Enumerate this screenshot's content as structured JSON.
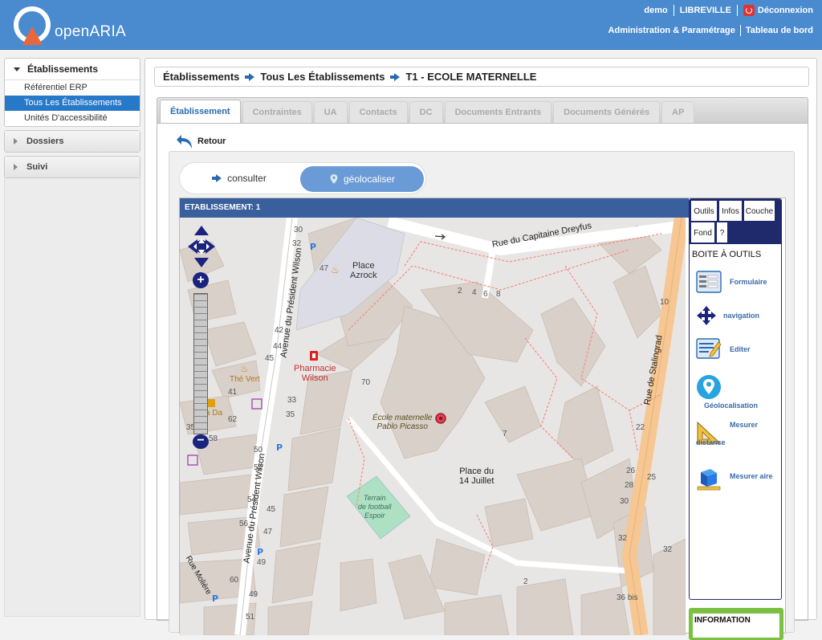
{
  "header": {
    "app_name": "openARIA",
    "user": "demo",
    "collectivite": "LIBREVILLE",
    "logout_label": "Déconnexion",
    "admin_label": "Administration & Paramétrage",
    "dashboard_label": "Tableau de bord",
    "brand_color": "#4a8bd0"
  },
  "sidebar": {
    "etablissements": {
      "title": "Établissements",
      "items": [
        {
          "label": "Référentiel ERP",
          "active": false
        },
        {
          "label": "Tous Les Établissements",
          "active": true
        },
        {
          "label": "Unités D'accessibilité",
          "active": false
        }
      ]
    },
    "dossiers": {
      "title": "Dossiers"
    },
    "suivi": {
      "title": "Suivi"
    }
  },
  "breadcrumb": [
    "Établissements",
    "Tous Les Établissements",
    "T1 - ECOLE MATERNELLE"
  ],
  "tabs": [
    {
      "label": "Établissement",
      "active": true
    },
    {
      "label": "Contraintes",
      "active": false
    },
    {
      "label": "UA",
      "active": false
    },
    {
      "label": "Contacts",
      "active": false
    },
    {
      "label": "DC",
      "active": false
    },
    {
      "label": "Documents Entrants",
      "active": false
    },
    {
      "label": "Documents Générés",
      "active": false
    },
    {
      "label": "AP",
      "active": false
    }
  ],
  "retour_label": "Retour",
  "mode_toggle": {
    "consult_label": "consulter",
    "geoloc_label": "géolocaliser",
    "active": "géolocaliser"
  },
  "map": {
    "title": "ETABLISSEMENT: 1",
    "labels": {
      "place_azrock": "Place\nAzrock",
      "rue_dreyfus": "Rue du Capitaine Dreyfus",
      "av_wilson_1": "Avenue du Président Wilson",
      "av_wilson_2": "Avenue du Président Wilson",
      "rue_stalingrad": "Rue de Stalingrad",
      "pharmacie": "Pharmacie\nWilson",
      "ecole": "École maternelle\nPablo Picasso",
      "place_14": "Place du\n14 Juillet",
      "terrain": "Terrain\nde football\nEspoir",
      "the_vert": "Thé Vert",
      "va_da": "Va Da",
      "rue_moliere": "Rue Molière"
    },
    "house_numbers": [
      "30",
      "32",
      "47",
      "2",
      "4",
      "6",
      "8",
      "42",
      "44",
      "45",
      "70",
      "41",
      "33",
      "35",
      "62",
      "7",
      "22",
      "35",
      "58",
      "50",
      "52",
      "54",
      "56",
      "47",
      "49",
      "45",
      "60",
      "49",
      "51",
      "10",
      "26",
      "25",
      "28",
      "30",
      "32",
      "32",
      "36 bis",
      "2"
    ]
  },
  "toolbox": {
    "buttons": [
      "Outils",
      "Infos",
      "Couche",
      "Fond",
      "?"
    ],
    "title": "BOITE À OUTILS",
    "tools": [
      "Formulaire",
      "navigation",
      "Editer",
      "Géolocalisation",
      "Mesurer distance",
      "Mesurer aire"
    ],
    "tool_distance_1": "Mesurer",
    "tool_distance_2": "distance",
    "info_label": "INFORMATION"
  }
}
